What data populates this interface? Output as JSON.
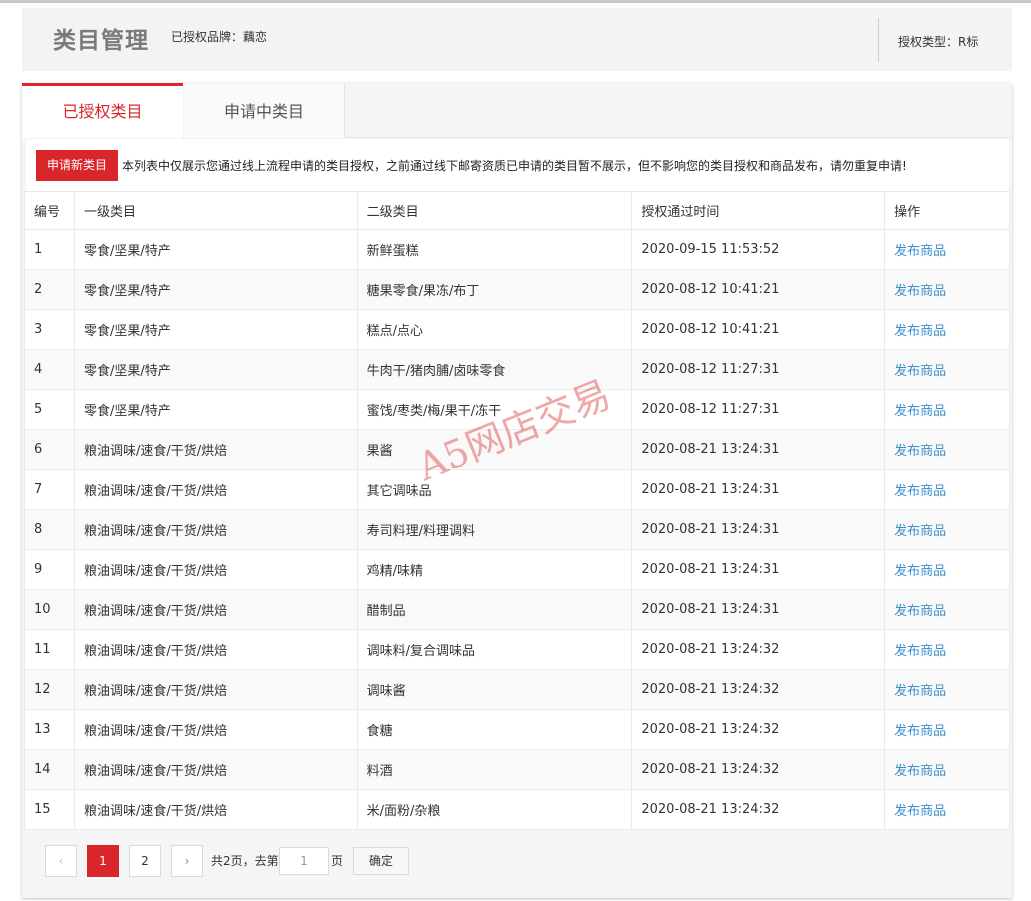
{
  "header": {
    "title": "类目管理",
    "brand": "已授权品牌：藕恋",
    "auth_type": "授权类型：R标"
  },
  "tabs": [
    {
      "label": "已授权类目",
      "active": true
    },
    {
      "label": "申请中类目",
      "active": false
    }
  ],
  "toolbar": {
    "apply_label": "申请新类目",
    "notice": "本列表中仅展示您通过线上流程申请的类目授权，之前通过线下邮寄资质已申请的类目暂不展示，但不影响您的类目授权和商品发布，请勿重复申请!"
  },
  "table": {
    "headers": [
      "编号",
      "一级类目",
      "二级类目",
      "授权通过时间",
      "操作"
    ],
    "rows": [
      {
        "id": "1",
        "cat1": "零食/坚果/特产",
        "cat2": "新鲜蛋糕",
        "time": "2020-09-15 11:53:52",
        "action": "发布商品"
      },
      {
        "id": "2",
        "cat1": "零食/坚果/特产",
        "cat2": "糖果零食/果冻/布丁",
        "time": "2020-08-12 10:41:21",
        "action": "发布商品"
      },
      {
        "id": "3",
        "cat1": "零食/坚果/特产",
        "cat2": "糕点/点心",
        "time": "2020-08-12 10:41:21",
        "action": "发布商品"
      },
      {
        "id": "4",
        "cat1": "零食/坚果/特产",
        "cat2": "牛肉干/猪肉脯/卤味零食",
        "time": "2020-08-12 11:27:31",
        "action": "发布商品"
      },
      {
        "id": "5",
        "cat1": "零食/坚果/特产",
        "cat2": "蜜饯/枣类/梅/果干/冻干",
        "time": "2020-08-12 11:27:31",
        "action": "发布商品"
      },
      {
        "id": "6",
        "cat1": "粮油调味/速食/干货/烘焙",
        "cat2": "果酱",
        "time": "2020-08-21 13:24:31",
        "action": "发布商品"
      },
      {
        "id": "7",
        "cat1": "粮油调味/速食/干货/烘焙",
        "cat2": "其它调味品",
        "time": "2020-08-21 13:24:31",
        "action": "发布商品"
      },
      {
        "id": "8",
        "cat1": "粮油调味/速食/干货/烘焙",
        "cat2": "寿司料理/料理调料",
        "time": "2020-08-21 13:24:31",
        "action": "发布商品"
      },
      {
        "id": "9",
        "cat1": "粮油调味/速食/干货/烘焙",
        "cat2": "鸡精/味精",
        "time": "2020-08-21 13:24:31",
        "action": "发布商品"
      },
      {
        "id": "10",
        "cat1": "粮油调味/速食/干货/烘焙",
        "cat2": "醋制品",
        "time": "2020-08-21 13:24:31",
        "action": "发布商品"
      },
      {
        "id": "11",
        "cat1": "粮油调味/速食/干货/烘焙",
        "cat2": "调味料/复合调味品",
        "time": "2020-08-21 13:24:32",
        "action": "发布商品"
      },
      {
        "id": "12",
        "cat1": "粮油调味/速食/干货/烘焙",
        "cat2": "调味酱",
        "time": "2020-08-21 13:24:32",
        "action": "发布商品"
      },
      {
        "id": "13",
        "cat1": "粮油调味/速食/干货/烘焙",
        "cat2": "食糖",
        "time": "2020-08-21 13:24:32",
        "action": "发布商品"
      },
      {
        "id": "14",
        "cat1": "粮油调味/速食/干货/烘焙",
        "cat2": "料酒",
        "time": "2020-08-21 13:24:32",
        "action": "发布商品"
      },
      {
        "id": "15",
        "cat1": "粮油调味/速食/干货/烘焙",
        "cat2": "米/面粉/杂粮",
        "time": "2020-08-21 13:24:32",
        "action": "发布商品"
      }
    ]
  },
  "pager": {
    "prev": "‹",
    "next": "›",
    "page1": "1",
    "page2": "2",
    "total": "共2页，去第",
    "input_value": "1",
    "unit": "页",
    "confirm": "确定"
  },
  "watermark": "A5网店交易",
  "colors": {
    "accent": "#d8262b",
    "link": "#3a8fcb"
  }
}
